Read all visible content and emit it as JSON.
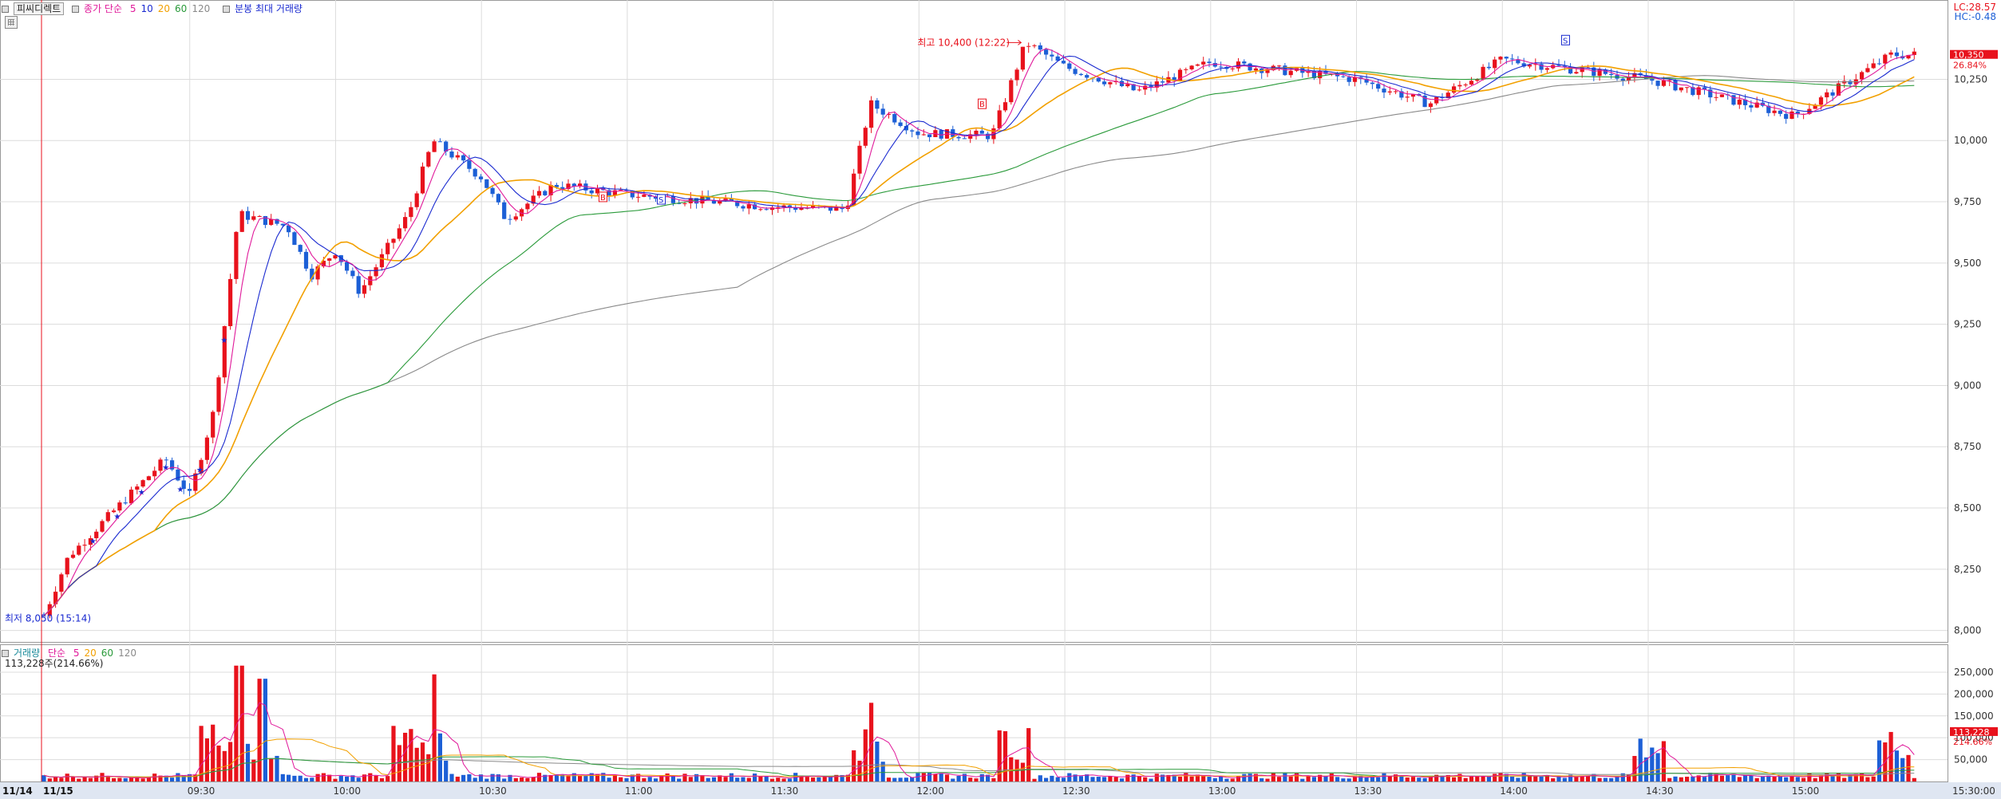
{
  "header": {
    "stock_name": "피씨디렉트",
    "price_legend_label": "종가 단순",
    "ma_periods": [
      {
        "label": "5",
        "color": "#e0199a"
      },
      {
        "label": "10",
        "color": "#1a2ad0"
      },
      {
        "label": "20",
        "color": "#f2a000"
      },
      {
        "label": "60",
        "color": "#2a9a3a"
      },
      {
        "label": "120",
        "color": "#8a8a8a"
      }
    ],
    "bunbong_label": "분봉 최대 거래량",
    "lc_label": "LC:28.57",
    "hc_label": "HC:-0.48"
  },
  "volume_header": {
    "label": "거래량",
    "ma_label": "단순",
    "ma_periods": [
      {
        "label": "5",
        "color": "#e0199a"
      },
      {
        "label": "20",
        "color": "#f2a000"
      },
      {
        "label": "60",
        "color": "#2a9a3a"
      },
      {
        "label": "120",
        "color": "#8a8a8a"
      }
    ],
    "current_volume": "113,228주(214.66%)"
  },
  "annotations": {
    "high_label": "최고 10,400 (12:22)",
    "low_label": "최저 8,050 (15:14)",
    "current_price_tag": "10,350",
    "current_change_tag": "26.84%",
    "current_volume_tag": "113,228",
    "current_volume_pct_tag": "214.66%",
    "badges": [
      "B",
      "S",
      "B",
      "S"
    ]
  },
  "x_axis": {
    "date_labels": [
      "11/14",
      "11/15"
    ],
    "time_labels": [
      "09:30",
      "10:00",
      "10:30",
      "11:00",
      "11:30",
      "12:00",
      "12:30",
      "13:00",
      "13:30",
      "14:00",
      "14:30",
      "15:00",
      "15:30:00"
    ]
  },
  "colors": {
    "up": "#e8121c",
    "down": "#1c5fd6",
    "grid": "#dcdcdc",
    "highlight": "#e8121c"
  },
  "chart_data": [
    {
      "type": "candlestick",
      "title": "피씨디렉트",
      "ylim": [
        7950,
        10450
      ],
      "y_ticks": [
        8000,
        8250,
        8500,
        8750,
        9000,
        9250,
        9500,
        9750,
        10000,
        10250
      ],
      "y_tick_labels": [
        "8,000",
        "8,250",
        "8,500",
        "8,750",
        "9,000",
        "9,250",
        "9,500",
        "9,750",
        "10,000",
        "10,250"
      ],
      "x": [
        "11/14",
        "11/15 09:00",
        "09:30",
        "10:00",
        "10:30",
        "11:00",
        "11:30",
        "12:00",
        "12:30",
        "13:00",
        "13:30",
        "14:00",
        "14:30",
        "15:00",
        "15:30"
      ],
      "close_path": [
        {
          "time": "11/14",
          "value": 8050
        },
        {
          "time": "09:00",
          "value": 8060
        },
        {
          "time": "09:05",
          "value": 8300
        },
        {
          "time": "09:15",
          "value": 8500
        },
        {
          "time": "09:25",
          "value": 8700
        },
        {
          "time": "09:30",
          "value": 8550
        },
        {
          "time": "09:35",
          "value": 8900
        },
        {
          "time": "09:40",
          "value": 9700
        },
        {
          "time": "09:50",
          "value": 9650
        },
        {
          "time": "09:55",
          "value": 9450
        },
        {
          "time": "10:00",
          "value": 9550
        },
        {
          "time": "10:05",
          "value": 9380
        },
        {
          "time": "10:15",
          "value": 9700
        },
        {
          "time": "10:20",
          "value": 10000
        },
        {
          "time": "10:30",
          "value": 9850
        },
        {
          "time": "10:35",
          "value": 9680
        },
        {
          "time": "10:45",
          "value": 9820
        },
        {
          "time": "11:00",
          "value": 9780
        },
        {
          "time": "11:30",
          "value": 9730
        },
        {
          "time": "11:45",
          "value": 9720
        },
        {
          "time": "11:50",
          "value": 10150
        },
        {
          "time": "12:00",
          "value": 10030
        },
        {
          "time": "12:15",
          "value": 10020
        },
        {
          "time": "12:22",
          "value": 10400
        },
        {
          "time": "12:30",
          "value": 10300
        },
        {
          "time": "12:45",
          "value": 10200
        },
        {
          "time": "13:00",
          "value": 10320
        },
        {
          "time": "13:30",
          "value": 10250
        },
        {
          "time": "13:45",
          "value": 10150
        },
        {
          "time": "14:00",
          "value": 10330
        },
        {
          "time": "14:30",
          "value": 10250
        },
        {
          "time": "15:00",
          "value": 10100
        },
        {
          "time": "15:20",
          "value": 10350
        }
      ],
      "high": 10400,
      "low": 8050,
      "last": 10350,
      "legend": [
        "5",
        "10",
        "20",
        "60",
        "120"
      ]
    },
    {
      "type": "bar",
      "title": "거래량",
      "ylim": [
        0,
        270000
      ],
      "y_ticks": [
        50000,
        100000,
        150000,
        200000,
        250000
      ],
      "y_tick_labels": [
        "50,000",
        "100,000",
        "150,000",
        "200,000",
        "250,000"
      ],
      "peaks": [
        {
          "time": "09:40",
          "value": 265000
        },
        {
          "time": "09:45",
          "value": 235000
        },
        {
          "time": "09:35",
          "value": 130000
        },
        {
          "time": "10:20",
          "value": 245000
        },
        {
          "time": "10:15",
          "value": 120000
        },
        {
          "time": "11:50",
          "value": 180000
        },
        {
          "time": "12:20",
          "value": 50000
        },
        {
          "time": "14:30",
          "value": 55000
        },
        {
          "time": "15:20",
          "value": 113228
        }
      ],
      "last": 113228,
      "legend": [
        "5",
        "20",
        "60",
        "120"
      ]
    }
  ]
}
